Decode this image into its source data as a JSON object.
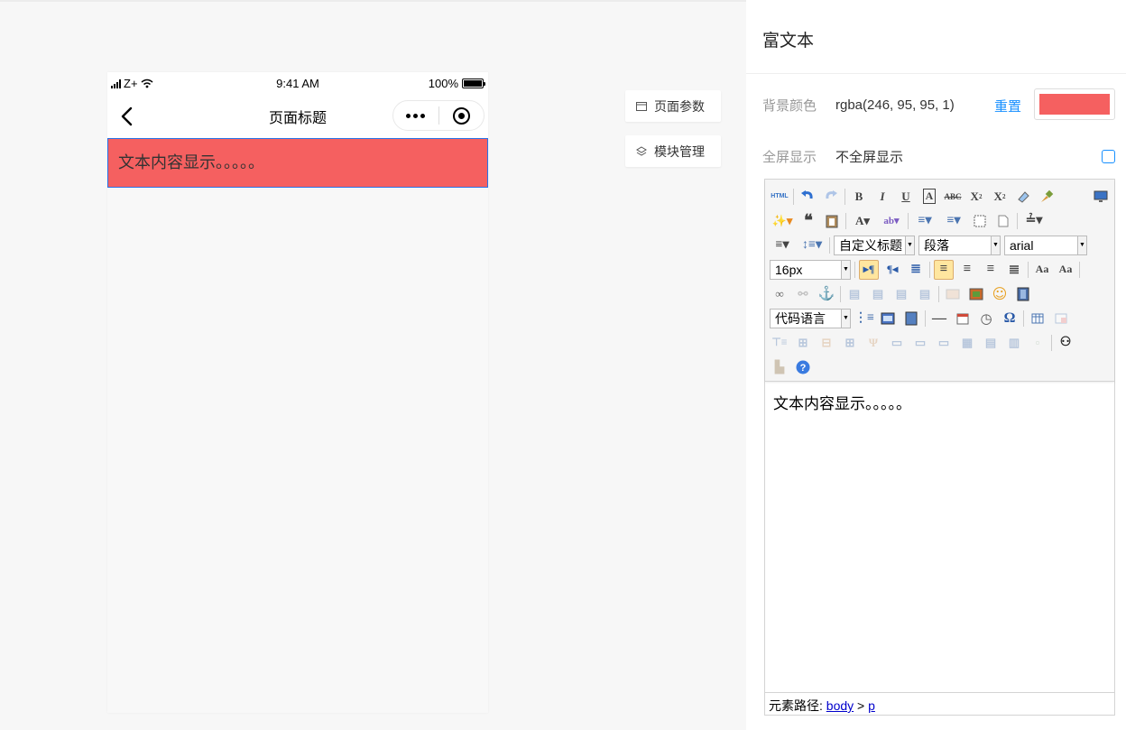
{
  "phone": {
    "status": {
      "carrier": "Z+",
      "time": "9:41 AM",
      "battery": "100%",
      "battery_level": 1.0
    },
    "nav": {
      "title": "页面标题"
    },
    "rich_text": {
      "content": "文本内容显示。。。。。",
      "bg_color": "#f56060"
    }
  },
  "floating": {
    "page_params": "页面参数",
    "module_mgmt": "模块管理"
  },
  "panel": {
    "title": "富文本",
    "bg": {
      "label": "背景颜色",
      "value": "rgba(246, 95, 95, 1)",
      "reset": "重置",
      "swatch_color": "#f56060"
    },
    "fullscreen": {
      "label": "全屏显示",
      "value": "不全屏显示",
      "checked": false
    },
    "editor": {
      "toolbar": {
        "heading_select": "自定义标题",
        "paragraph_select": "段落",
        "font_select": "arial",
        "size_select": "16px",
        "code_select": "代码语言",
        "html_label": "HTML"
      },
      "content": "文本内容显示。。。。。",
      "path_label": "元素路径:",
      "path_body": "body",
      "path_sep": ">",
      "path_p": "p"
    }
  },
  "colors": {
    "accent": "#1890ff",
    "rich_bg": "#f56060",
    "selection_border": "#2a72e6"
  }
}
